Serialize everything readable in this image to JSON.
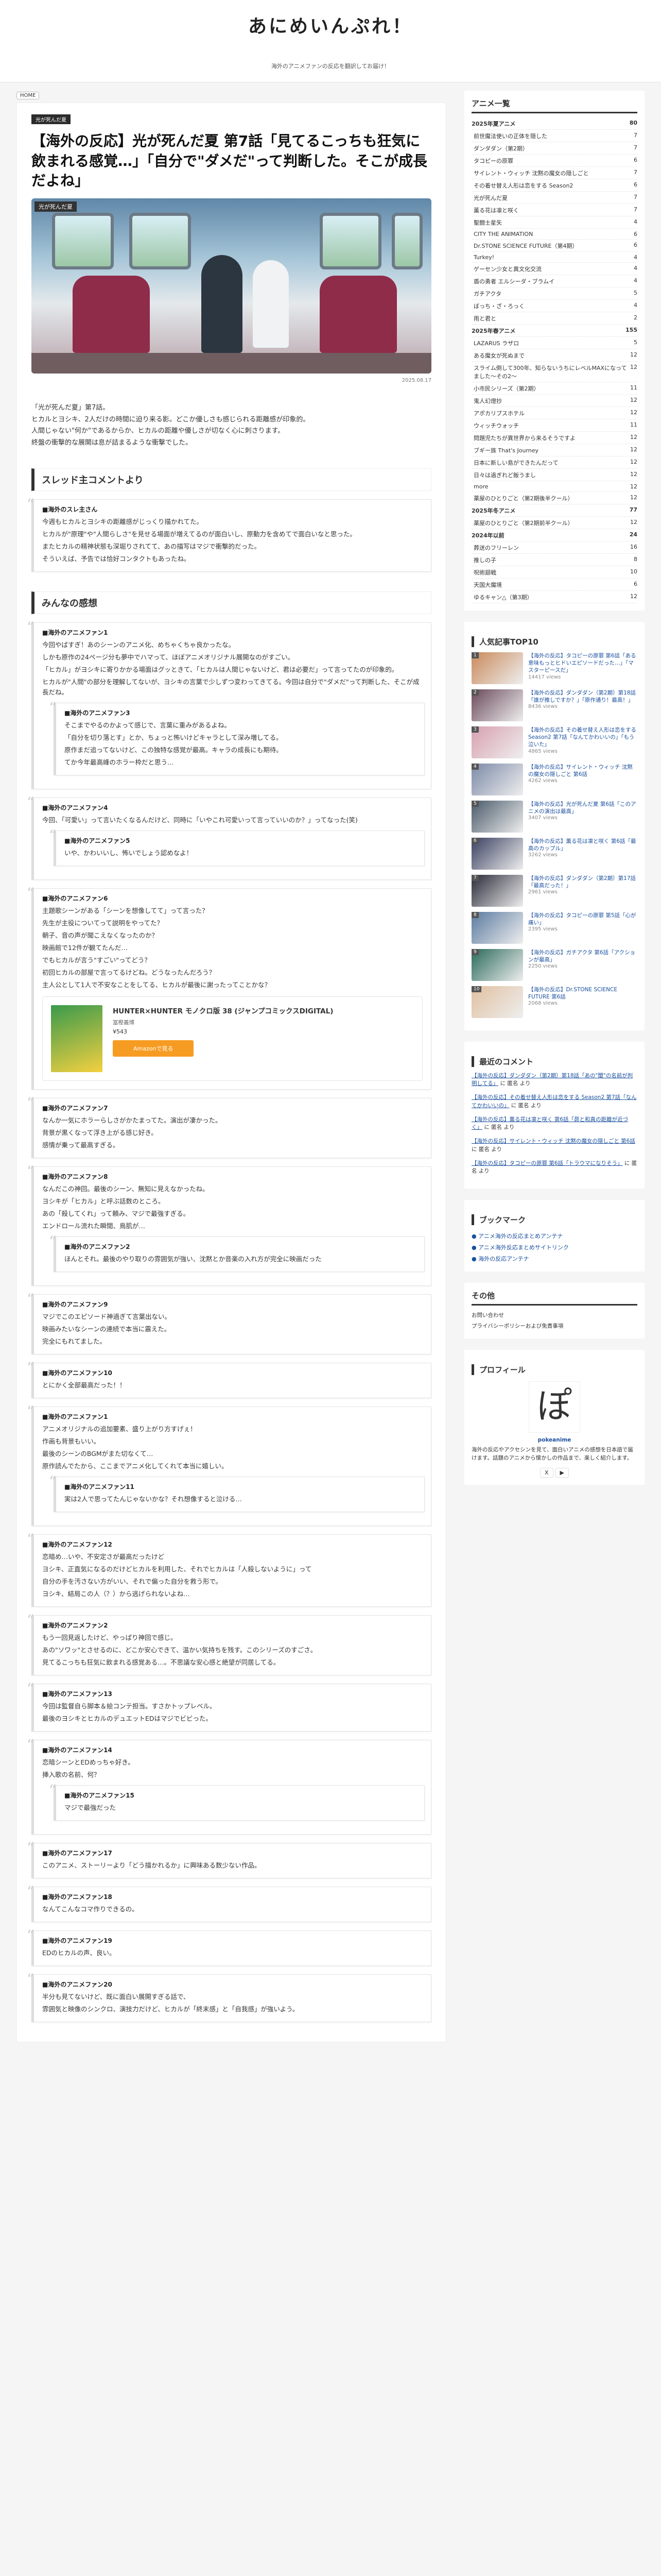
{
  "site": {
    "logo": "あにめいんぷれ！",
    "tagline": "海外のアニメファンの反応を翻訳してお届け！"
  },
  "breadcrumb": "HOME",
  "article": {
    "category": "光が死んだ夏",
    "title": "【海外の反応】光が死んだ夏 第7話「見てるこっちも狂気に飲まれる感覚…」「自分で\"ダメだ\"って判断した。そこが成長だよね」",
    "image_caption": "光が死んだ夏",
    "date": "2025.08.17",
    "intro": [
      "「光が死んだ夏」第7話。",
      "ヒカルとヨシキ、2人だけの時間に迫り来る影。どこか優しさも感じられる距離感が印象的。",
      "人間じゃない\"何か\"であるからか、ヒカルの距離や優しさが切なく心に刺さります。",
      "終盤の衝撃的な展開は息が詰まるような衝撃でした。"
    ]
  },
  "thread": {
    "heading": "スレッド主コメントより",
    "name": "■海外のスレ主さん",
    "body": [
      "今週もヒカルとヨシキの距離感がじっくり描かれてた。",
      "ヒカルが\"原理\"や\"人間らしさ\"を見せる場面が増えてるのが面白いし、原動力を含めてで面白いなと思った。",
      "またヒカルの精神状態も深堀りされてて、あの描写はマジで衝撃的だった。",
      "そういえば、予告では恰好コンタクトもあったね。"
    ]
  },
  "comments_heading": "みんなの感想",
  "comments": [
    {
      "name": "■海外のアニメファン1",
      "body": [
        "今回やばすぎ！あのシーンのアニメ化、めちゃくちゃ良かったな。",
        "しかも原作の24ページ分も夢中でハマって、ほぼアニメオリジナル展開なのがすごい。",
        "「ヒカル」がヨシキに寄りかかる場面はグッときて、「ヒカルは人間じゃないけど、君は必要だ」って言ってたのが印象的。",
        "ヒカルが\"人間\"の部分を理解してないが、ヨシキの言葉で少しずつ変わってきてる。今回は自分で\"ダメだ\"って判断した、そこが成長だね。"
      ],
      "replies": [
        {
          "name": "■海外のアニメファン3",
          "body": [
            "そこまでやるのかよって感じで、言葉に重みがあるよね。",
            "「自分を切り落とす」とか、ちょっと怖いけどキャラとして深み増してる。",
            "原作まだ追ってないけど、この独特な感覚が最高。キャラの成長にも期待。",
            "てか今年最高峰のホラー枠だと思う…"
          ]
        }
      ]
    },
    {
      "name": "■海外のアニメファン4",
      "body": [
        "今回、「可愛い」って言いたくなるんだけど、同時に「いやこれ可愛いって言っていいのか？」ってなった(笑)"
      ],
      "replies": [
        {
          "name": "■海外のアニメファン5",
          "body": [
            "いや、かわいいし、怖いでしょう認めなよ！"
          ]
        }
      ]
    },
    {
      "name": "■海外のアニメファン6",
      "body": [
        "主題歌シーンがある「シーンを想像してて」って言った？",
        "先生が主役についてって説明をやってた？",
        "朝子、音の声が聞こえなくなったのか？",
        "映画館で12件が観てたんだ…",
        "でもヒカルが言う\"すごい\"ってどう？",
        "初回ヒカルの部屋で言ってるけどね。どうなったんだろう？",
        "主人公として1人で不安なことをしてる、ヒカルが最後に謝ったってことかな？"
      ],
      "book": {
        "title": "HUNTER×HUNTER モノクロ版 38 (ジャンプコミックスDIGITAL)",
        "author": "冨樫義博",
        "price": "¥543",
        "button": "Amazonで見る"
      }
    },
    {
      "name": "■海外のアニメファン7",
      "body": [
        "なんか一気にホラーらしさがかたまってた。演出が凄かった。",
        "背景が黒くなって浮き上がる感じ好き。",
        "感情が乗って最高すぎる。"
      ]
    },
    {
      "name": "■海外のアニメファン8",
      "body": [
        "なんだこの神回。最後のシーン、無知に見えなかったね。",
        "ヨシキが「ヒカル」と呼ぶ話数のところ。",
        "あの「殺してくれ」って頼み、マジで最強すぎる。",
        "エンドロール流れた瞬間、鳥肌が…"
      ],
      "replies": [
        {
          "name": "■海外のアニメファン2",
          "body": [
            "ほんとそれ。最後のやり取りの雰囲気が強い、沈黙とか音楽の入れ方が完全に映画だった"
          ]
        }
      ]
    },
    {
      "name": "■海外のアニメファン9",
      "body": [
        "マジでこのエピソード神過ぎて言葉出ない。",
        "映画みたいなシーンの連続で本当に震えた。",
        "完全にもれてました。"
      ]
    },
    {
      "name": "■海外のアニメファン10",
      "body": [
        "とにかく全部最高だった！！"
      ]
    },
    {
      "name": "■海外のアニメファン1",
      "body": [
        "アニメオリジナルの追加要素、盛り上がり方すげぇ！",
        "作画も背景もいい。",
        "最後のシーンのBGMがまた切なくて…",
        "原作読んでたから、ここまでアニメ化してくれて本当に嬉しい。"
      ],
      "replies": [
        {
          "name": "■海外のアニメファン11",
          "body": [
            "実は2人で思ってたんじゃないかな？それ想像すると泣ける…"
          ]
        }
      ]
    },
    {
      "name": "■海外のアニメファン12",
      "body": [
        "恋暗め…いや、不安定さが最高だったけど",
        "ヨシキ、正直気になるのだけどヒカルを利用した、それでヒカルは「人殺しないように」って",
        "自分の手を汚さない方がいい、それで偏った自分を救う形で。",
        "ヨシキ、結局この人（？）から逃げられないよね…"
      ]
    },
    {
      "name": "■海外のアニメファン2",
      "body": [
        "もう一回見返したけど、やっぱり神回で感じ。",
        "あの\"ソワッ\"とさせるのに、どこか安心できて、温かい気持ちを残す。このシリーズのすごさ。",
        "見てるこっちも狂気に飲まれる感覚ある…。不思議な安心感と絶望が同居してる。"
      ]
    },
    {
      "name": "■海外のアニメファン13",
      "body": [
        "今回は監督自ら脚本＆絵コンテ担当。すさかトップレベル。",
        "最後のヨシキとヒカルのデュエットEDはマジでビビった。"
      ]
    },
    {
      "name": "■海外のアニメファン14",
      "body": [
        "恋暗シーンとEDめっちゃ好き。",
        "挿入歌の名前、何？"
      ],
      "replies": [
        {
          "name": "■海外のアニメファン15",
          "body": [
            "マジで最強だった"
          ]
        }
      ]
    },
    {
      "name": "■海外のアニメファン17",
      "body": [
        "このアニメ、ストーリーより「どう描かれるか」に興味ある数少ない作品。"
      ]
    },
    {
      "name": "■海外のアニメファン18",
      "body": [
        "なんてこんなコマ作りできるの。"
      ]
    },
    {
      "name": "■海外のアニメファン19",
      "body": [
        "EDのヒカルの声、良い。"
      ]
    },
    {
      "name": "■海外のアニメファン20",
      "body": [
        "半分も見てないけど、既に面白い展開すぎる話で、",
        "雰囲気と映像のシンクロ、演技力だけど、ヒカルが「終末感」と「自我感」が強いよう。"
      ]
    }
  ],
  "sidebar": {
    "archive_title": "アニメ一覧",
    "archive": [
      {
        "t": "2025年夏アニメ",
        "c": "80",
        "m": true
      },
      {
        "t": "前世魔法使いの正体を隠した",
        "c": "7"
      },
      {
        "t": "ダンダダン（第2期）",
        "c": "7"
      },
      {
        "t": "タコピーの原罪",
        "c": "6"
      },
      {
        "t": "サイレント・ウィッチ 沈黙の魔女の隠しごと",
        "c": "7"
      },
      {
        "t": "その着せ替え人形は恋をする Season2",
        "c": "6"
      },
      {
        "t": "光が死んだ夏",
        "c": "7"
      },
      {
        "t": "薫る花は凛と咲く",
        "c": "7"
      },
      {
        "t": "聖闘士星矢",
        "c": "4"
      },
      {
        "t": "CITY THE ANIMATION",
        "c": "6"
      },
      {
        "t": "Dr.STONE SCIENCE FUTURE（第4期）",
        "c": "6"
      },
      {
        "t": "Turkey!",
        "c": "4"
      },
      {
        "t": "ゲーセン少女と異文化交流",
        "c": "4"
      },
      {
        "t": "盾の勇者 エルシーダ・ブラムイ",
        "c": "4"
      },
      {
        "t": "ガチアクタ",
        "c": "5"
      },
      {
        "t": "ぼっち・ざ・ろっく",
        "c": "4"
      },
      {
        "t": "雨と君と",
        "c": "2"
      },
      {
        "t": "2025年春アニメ",
        "c": "155",
        "m": true
      },
      {
        "t": "LAZARUS ラザロ",
        "c": "5"
      },
      {
        "t": "ある魔女が死ぬまで",
        "c": "12"
      },
      {
        "t": "スライム倒して300年、知らないうちにレベルMAXになってました～その2～",
        "c": "12"
      },
      {
        "t": "小市民シリーズ（第2期）",
        "c": "11"
      },
      {
        "t": "鬼人幻燈抄",
        "c": "12"
      },
      {
        "t": "アポカリプスホテル",
        "c": "12"
      },
      {
        "t": "ウィッチウォッチ",
        "c": "11"
      },
      {
        "t": "問題児たちが異世界から来るそうですよ",
        "c": "12"
      },
      {
        "t": "ブギー族 That's Journey",
        "c": "12"
      },
      {
        "t": "日本に新しい島ができたんだって",
        "c": "12"
      },
      {
        "t": "日々は過ぎれど飯うまし",
        "c": "12"
      },
      {
        "t": "more",
        "c": "12"
      },
      {
        "t": "薬屋のひとりごと（第2期後半クール）",
        "c": "12"
      },
      {
        "t": "2025年冬アニメ",
        "c": "77",
        "m": true
      },
      {
        "t": "薬屋のひとりごと（第2期前半クール）",
        "c": "12"
      },
      {
        "t": "2024年以前",
        "c": "24",
        "m": true
      },
      {
        "t": "葬送のフリーレン",
        "c": "16"
      },
      {
        "t": "推しの子",
        "c": "8"
      },
      {
        "t": "呪術廻戦",
        "c": "10"
      },
      {
        "t": "天国大魔境",
        "c": "6"
      },
      {
        "t": "ゆるキャン△（第3期）",
        "c": "12"
      }
    ],
    "top_title": "人気記事TOP10",
    "ranking": [
      {
        "t": "【海外の反応】タコピーの原罪 第6話「ある意味もっとヒドいエピソードだった…」「マスターピースだ」",
        "v": "14417 views",
        "c": "#c9895a"
      },
      {
        "t": "【海外の反応】ダンダダン（第2期）第18話「誰が推しですか？」「原作通り！最高！」",
        "v": "8436 views",
        "c": "#6a4a5a"
      },
      {
        "t": "【海外の反応】その着せ替え人形は恋をする Season2 第7話「なんてかわいいの」「もう泣いた」",
        "v": "4865 views",
        "c": "#d8a0b0"
      },
      {
        "t": "【海外の反応】サイレント・ウィッチ 沈黙の魔女の隠しごと 第6話",
        "v": "4262 views",
        "c": "#7c8aa8"
      },
      {
        "t": "【海外の反応】光が死んだ夏 第6話「このアニメの演出は最高」",
        "v": "3407 views",
        "c": "#4a5a6a"
      },
      {
        "t": "【海外の反応】薫る花は凛と咲く 第6話「最高のカップル」",
        "v": "3262 views",
        "c": "#3a4060"
      },
      {
        "t": "【海外の反応】ダンダダン（第2期）第17話「最高だった！」",
        "v": "2961 views",
        "c": "#2a2a3a"
      },
      {
        "t": "【海外の反応】タコピーの原罪 第5話「心が痛い」",
        "v": "2395 views",
        "c": "#5a7aa0"
      },
      {
        "t": "【海外の反応】ガチアクタ 第6話「アクションが最高」",
        "v": "2250 views",
        "c": "#2a6a5a"
      },
      {
        "t": "【海外の反応】Dr.STONE SCIENCE FUTURE 第6話",
        "v": "2068 views",
        "c": "#e0c0a0"
      }
    ],
    "recent_title": "最近のコメント",
    "recent": [
      {
        "l": "【海外の反応】ダンダダン（第2期）第18話「あの\"闇\"の名前が判明してる」",
        "who": "に 匿名 より"
      },
      {
        "l": "【海外の反応】その着せ替え人形は恋をする Season2 第7話「なんてかわいいの」",
        "who": "に 匿名 より"
      },
      {
        "l": "【海外の反応】薫る花は凛と咲く 第6話「昴と和真の距離が近づく」",
        "who": "に 匿名 より"
      },
      {
        "l": "【海外の反応】サイレント・ウィッチ 沈黙の魔女の隠しごと 第6話",
        "who": "に 匿名 より"
      },
      {
        "l": "【海外の反応】タコピーの原罪 第6話「トラウマになりそう」",
        "who": "に 匿名 より"
      }
    ],
    "bookmark_title": "ブックマーク",
    "bookmarks": [
      "アニメ海外の反応まとめアンテナ",
      "アニメ海外反応まとめサイトリンク",
      "海外の反応アンテナ"
    ],
    "other_title": "その他",
    "others": [
      "お問い合わせ",
      "プライバシーポリシーおよび免責事項"
    ],
    "profile_title": "プロフィール",
    "profile_avatar": "ぽ",
    "profile_name": "pokeanime",
    "profile_text": "海外の反応やアクセシンを見て、面白いアニメの感想を日本語で届けます。話題のアニメから懐かしの作品まで、楽しく紹介します。",
    "follow": [
      "X",
      "▶"
    ]
  }
}
